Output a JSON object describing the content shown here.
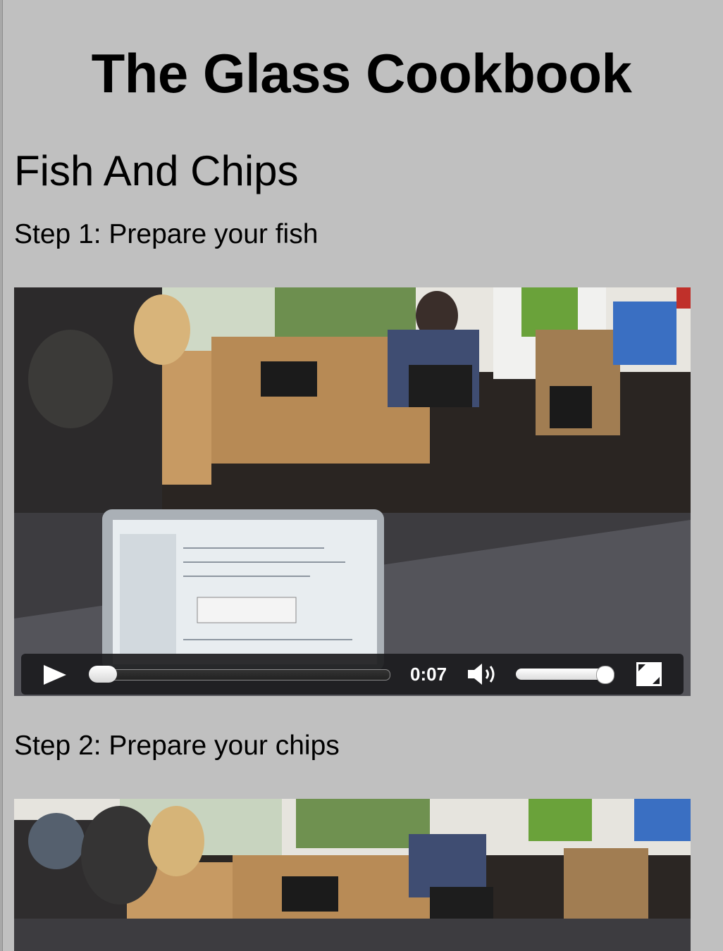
{
  "page": {
    "title": "The Glass Cookbook",
    "recipe_title": "Fish And Chips",
    "background": "#c0c0c0"
  },
  "steps": [
    {
      "label": "Step 1: Prepare your fish",
      "video": {
        "time": "0:07",
        "playback_progress": 0.02,
        "volume": 1.0,
        "icons": [
          "play-icon",
          "volume-icon",
          "fullscreen-icon"
        ]
      }
    },
    {
      "label": "Step 2: Prepare your chips"
    }
  ]
}
